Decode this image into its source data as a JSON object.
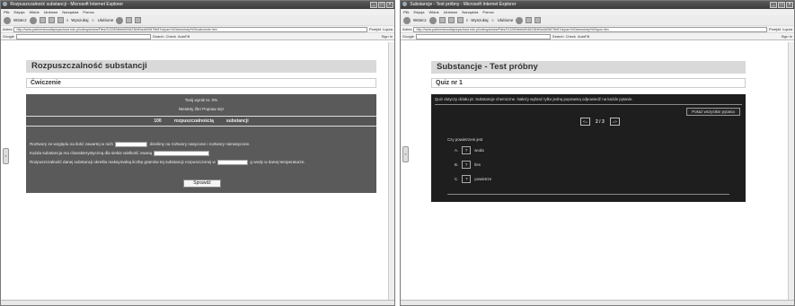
{
  "left_window": {
    "title": "Rozpuszczalność substancji - Microsoft Internet Explorer",
    "menu": [
      "Plik",
      "Edycja",
      "Widok",
      "Ulubione",
      "Narzędzia",
      "Pomoc"
    ],
    "toolbar": {
      "back": "Wstecz",
      "search": "Wyszukaj",
      "favorites": "Ulubione"
    },
    "address": {
      "label": "Adres",
      "url": "http://www.partnerstwodlaprzyszlosci.edu.pl/zdecydowka/Files/9132894bbb69462384f0a4d05879b87/a/pan%20chemistry%20cwiczenie.htm",
      "go": "Przejdź",
      "links": "Łącza"
    },
    "googlebar": {
      "label": "Google",
      "search": "Search",
      "check": "Check",
      "autofill": "AutoFill",
      "signin": "Sign In"
    },
    "page": {
      "header": "Rozpuszczalność substancji",
      "subheader": "Ćwiczenie",
      "score": "Twój wynik to: 0%",
      "feedback": "Niestety źle! Popraw się!",
      "answers": [
        "100",
        "rozpuszczalnością",
        "substancji"
      ],
      "sentence1_a": "Roztwory ze względu na ilość zawartej w nich",
      "sentence1_b": "dzielimy na roztwory nasycone i roztwory nienasycone.",
      "sentence2": "Każda substancja ma charakterystyczną dla siebie wielkość zwaną",
      "sentence3_a": "Rozpuszczalność danej substancji określa maksymalną liczbę gramów tej substancji rozpuszczonej w",
      "sentence3_b": "g wody w danej temperaturze.",
      "check_button": "Sprawdź"
    }
  },
  "right_window": {
    "title": "Substancje - Test próbny - Microsoft Internet Explorer",
    "menu": [
      "Plik",
      "Edycja",
      "Widok",
      "Ulubione",
      "Narzędzia",
      "Pomoc"
    ],
    "toolbar": {
      "back": "Wstecz",
      "search": "Wyszukaj",
      "favorites": "Ulubione"
    },
    "address": {
      "label": "Adres",
      "url": "http://www.partnerstwodlaprzyszlosci.edu.pl/zdecydowka/Files/9132894bbb69462384f0a4d05879b87/a/pan%20chemistry%20quiz.htm",
      "go": "Przejdź",
      "links": "Łącza"
    },
    "googlebar": {
      "label": "Google",
      "search": "Search",
      "check": "Check",
      "autofill": "AutoFill",
      "signin": "Sign In"
    },
    "page": {
      "header": "Substancje - Test próbny",
      "subheader": "Quiz nr 1",
      "intro": "Quiz dotyczy działu pt. Substancje chemiczne. Należy wybrać tylko jedną poprawną odpowiedź na każde pytanie.",
      "show_all": "Pokaż wszystkie pytania",
      "prev": "<=",
      "next": "=>",
      "counter": "2 / 3",
      "question": "Czy powietrzem jest",
      "options": [
        {
          "letter": "A.",
          "mark": "?",
          "text": "woda"
        },
        {
          "letter": "B.",
          "mark": "?",
          "text": "tlen"
        },
        {
          "letter": "C.",
          "mark": "?",
          "text": "powietrze"
        }
      ]
    }
  }
}
